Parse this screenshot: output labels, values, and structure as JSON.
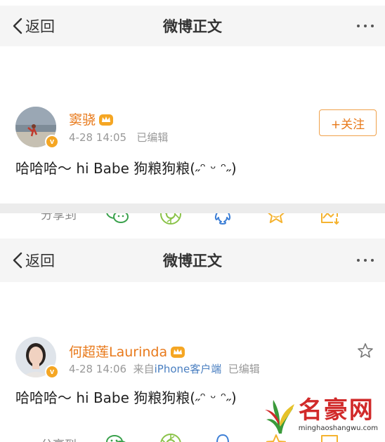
{
  "screens": [
    {
      "nav": {
        "back_label": "返回",
        "title": "微博正文"
      },
      "post": {
        "author": "窦骁",
        "time": "4-28 14:05",
        "edited": "已编辑",
        "source_prefix": "",
        "source": "",
        "follow_label": "+关注",
        "content": "哈哈哈～ hi Babe 狗粮狗粮(˶ᵔ ᵕ ᵔ˶)",
        "verified_badge": "v"
      },
      "share": {
        "label": "分享到"
      }
    },
    {
      "nav": {
        "back_label": "返回",
        "title": "微博正文"
      },
      "post": {
        "author": "何超莲Laurinda",
        "time": "4-28 14:06",
        "edited": "已编辑",
        "source_prefix": "来自",
        "source": "iPhone客户端",
        "content": "哈哈哈～ hi Babe 狗粮狗粮(˶ᵔ ᵕ ᵔ˶)",
        "verified_badge": "v"
      },
      "share": {
        "label": "分享到"
      }
    }
  ],
  "icons": [
    "back-chevron-icon",
    "more-dots-icon",
    "crown-icon",
    "wechat-icon",
    "moments-icon",
    "qq-icon",
    "favorite-star-icon",
    "save-image-icon"
  ],
  "colors": {
    "accent": "#e8791a",
    "icon": "#f5b330",
    "wechat": "#3aa14c",
    "moments": "#8bc34a",
    "qq": "#3d7fd6",
    "link": "#4a7fc1"
  },
  "watermark": {
    "title": "名豪网",
    "url": "minghaoshangwu.com"
  }
}
